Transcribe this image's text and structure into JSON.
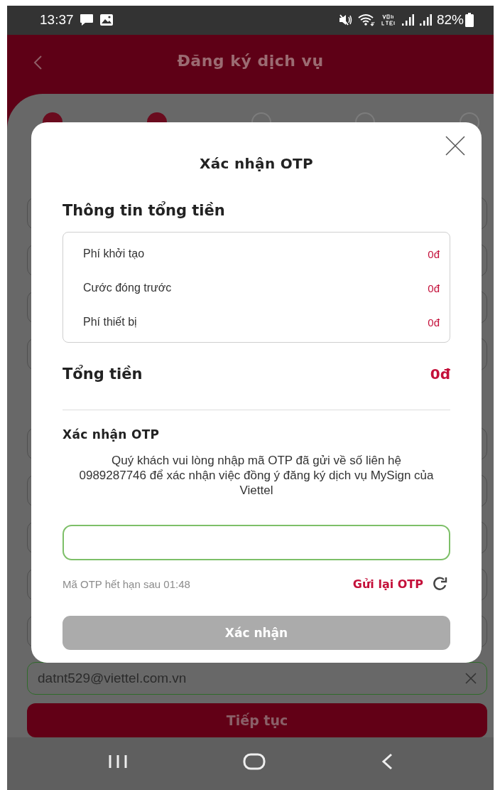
{
  "status_bar": {
    "time": "13:37",
    "battery": "82%"
  },
  "header": {
    "title": "Đăng ký dịch vụ"
  },
  "steps": [
    {
      "done": true
    },
    {
      "done": true
    },
    {
      "done": false
    },
    {
      "done": false
    },
    {
      "done": false
    }
  ],
  "form": {
    "sections": [
      {
        "fields": [
          {
            "kind": "blank"
          },
          {
            "kind": "blank"
          },
          {
            "kind": "blank"
          },
          {
            "kind": "blank"
          }
        ]
      },
      {
        "fields": [
          {
            "kind": "blank"
          },
          {
            "kind": "blank"
          },
          {
            "kind": "blank"
          },
          {
            "kind": "blank"
          },
          {
            "kind": "blank"
          },
          {
            "kind": "email",
            "value": "datnt529@viettel.com.vn"
          }
        ]
      }
    ],
    "submit": "Tiếp tục"
  },
  "dialog": {
    "title": "Xác nhận OTP",
    "summary_title": "Thông tin tổng tiền",
    "fees": [
      {
        "label": "Phí khởi tạo",
        "amount": "0đ"
      },
      {
        "label": "Cước đóng trước",
        "amount": "0đ"
      },
      {
        "label": "Phí thiết bị",
        "amount": "0đ"
      }
    ],
    "total_label": "Tổng tiền",
    "total_amount": "0đ",
    "otp_title": "Xác nhận OTP",
    "otp_message": "Quý khách vui lòng nhập mã OTP đã gửi về số liên hệ 0989287746 để xác nhận việc đồng ý đăng ký dịch vụ MySign của Viettel",
    "timer": "Mã OTP hết hạn sau 01:48",
    "resend": "Gửi lại OTP",
    "confirm": {
      "label": "Xác nhận",
      "disabled": true
    }
  }
}
